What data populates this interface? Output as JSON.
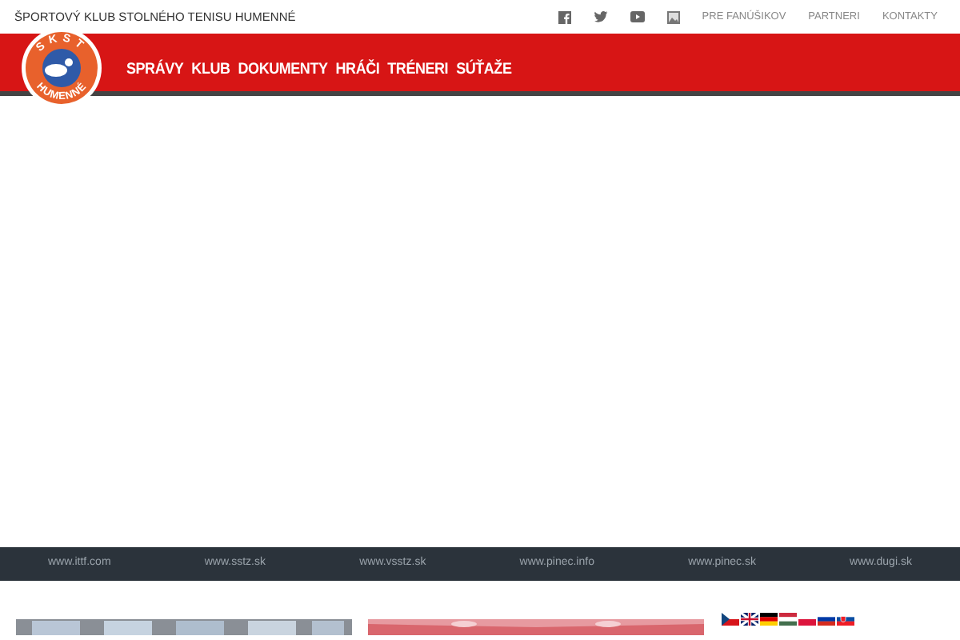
{
  "top_bar": {
    "title": "ŠPORTOVÝ KLUB STOLNÉHO TENISU HUMENNÉ",
    "links": [
      "PRE FANÚŠIKOV",
      "PARTNERI",
      "KONTAKTY"
    ]
  },
  "logo": {
    "top": "SKST",
    "bottom": "HUMENNÉ"
  },
  "nav": [
    "SPRÁVY",
    "KLUB",
    "DOKUMENTY",
    "HRÁČI",
    "TRÉNERI",
    "SÚŤAŽE"
  ],
  "link_bar": [
    "www.ittf.com",
    "www.sstz.sk",
    "www.vsstz.sk",
    "www.pinec.info",
    "www.pinec.sk",
    "www.dugi.sk"
  ]
}
